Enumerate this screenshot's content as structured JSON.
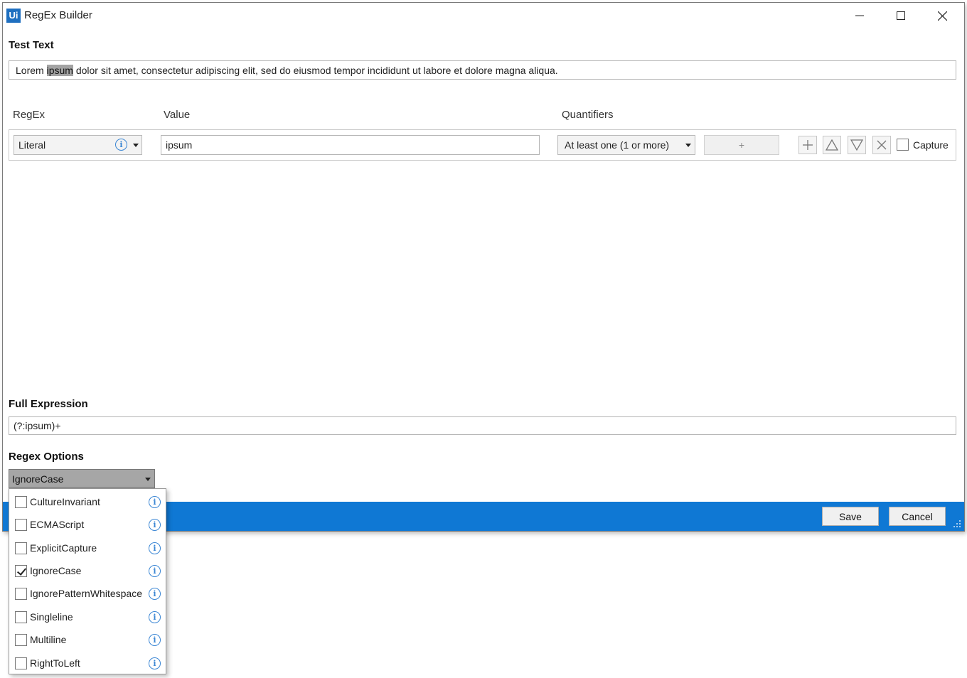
{
  "window": {
    "app_logo": "Ui",
    "title": "RegEx Builder"
  },
  "test_text": {
    "label": "Test Text",
    "before": "Lorem ",
    "match": "ipsum",
    "after": " dolor sit amet, consectetur adipiscing elit, sed do eiusmod tempor incididunt ut labore et dolore magna aliqua."
  },
  "columns": {
    "regex": "RegEx",
    "value": "Value",
    "quantifiers": "Quantifiers"
  },
  "row": {
    "regex_type": "Literal",
    "value": "ipsum",
    "quantifier": "At least one (1 or more)",
    "quantifier_extra": "+",
    "capture_label": "Capture",
    "capture_checked": false
  },
  "full_expression": {
    "label": "Full Expression",
    "value": "(?:ipsum)+"
  },
  "regex_options": {
    "label": "Regex Options",
    "selected": "IgnoreCase",
    "items": [
      {
        "label": "CultureInvariant",
        "checked": false
      },
      {
        "label": "ECMAScript",
        "checked": false
      },
      {
        "label": "ExplicitCapture",
        "checked": false
      },
      {
        "label": "IgnoreCase",
        "checked": true
      },
      {
        "label": "IgnorePatternWhitespace",
        "checked": false
      },
      {
        "label": "Singleline",
        "checked": false
      },
      {
        "label": "Multiline",
        "checked": false
      },
      {
        "label": "RightToLeft",
        "checked": false
      }
    ]
  },
  "footer": {
    "save_label": "Save",
    "cancel_label": "Cancel"
  },
  "icons": {
    "info": "info-icon",
    "add": "plus-icon",
    "move_up": "triangle-up-icon",
    "move_down": "triangle-down-icon",
    "delete": "x-icon"
  },
  "colors": {
    "accent": "#0f78d4",
    "info": "#3a86d4",
    "highlight": "#a3a3a3"
  }
}
